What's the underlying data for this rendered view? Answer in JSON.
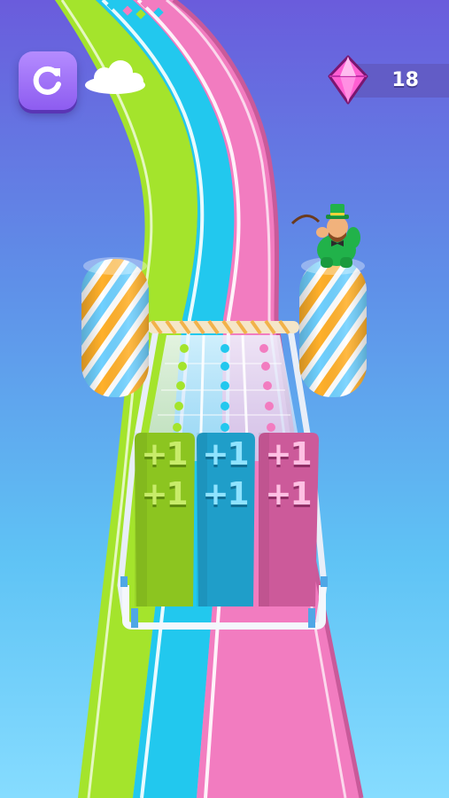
{
  "hud": {
    "restart_icon": "restart-icon",
    "gem_icon": "pink-gem-icon",
    "gem_count": "18"
  },
  "track": {
    "lanes": [
      {
        "name": "green",
        "color": "#a4e42c"
      },
      {
        "name": "blue",
        "color": "#22c8ee"
      },
      {
        "name": "pink",
        "color": "#f27cc0"
      }
    ]
  },
  "counters": [
    {
      "lane": "green",
      "labels": [
        "+1",
        "+1"
      ],
      "color": "#8cc520",
      "text_color": "#c8ec6a",
      "text_shadow": "#5f8c10"
    },
    {
      "lane": "blue",
      "labels": [
        "+1",
        "+1"
      ],
      "color": "#1f9ec9",
      "text_color": "#8fe3ff",
      "text_shadow": "#116f94"
    },
    {
      "lane": "pink",
      "labels": [
        "+1",
        "+1"
      ],
      "color": "#cc5a9a",
      "text_color": "#ffc0e3",
      "text_shadow": "#8f2f66"
    }
  ],
  "colors": {
    "sky_top": "#6a5cdc",
    "sky_bottom": "#7fd9ff",
    "marshmallow_stripe_a": "#ffb02a",
    "marshmallow_stripe_b": "#6fd0ff",
    "character_hat": "#21b24a"
  }
}
